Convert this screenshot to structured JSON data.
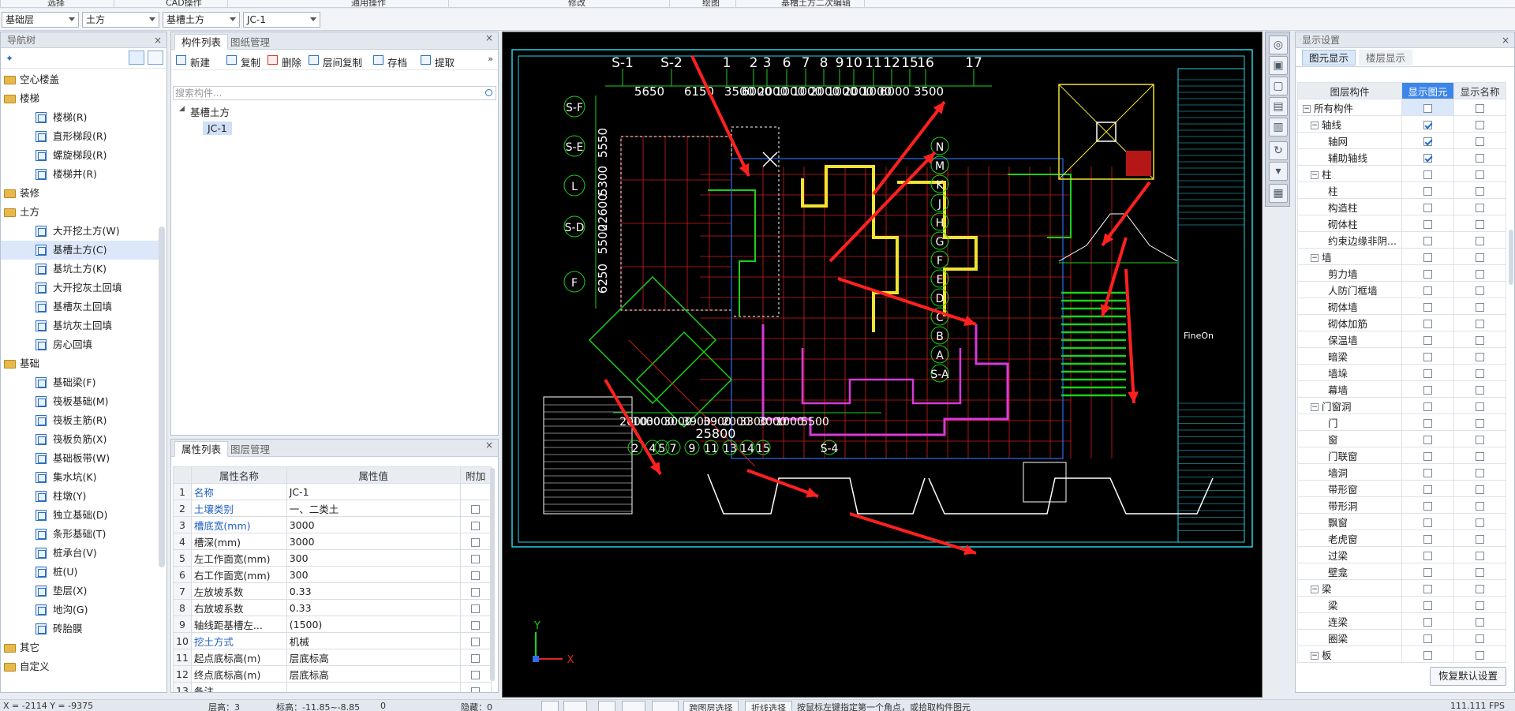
{
  "ribbon": {
    "groups": [
      "选择",
      "CAD操作",
      "通用操作",
      "修改",
      "绘图",
      "基槽土方二次编辑"
    ]
  },
  "combos": [
    "基础层",
    "土方",
    "基槽土方",
    "JC-1"
  ],
  "nav": {
    "title": "导航树",
    "tree": [
      {
        "type": "cat",
        "label": "空心楼盖"
      },
      {
        "type": "cat",
        "label": "楼梯"
      },
      {
        "type": "item",
        "label": "楼梯(R)"
      },
      {
        "type": "item",
        "label": "直形梯段(R)"
      },
      {
        "type": "item",
        "label": "螺旋梯段(R)"
      },
      {
        "type": "item",
        "label": "楼梯井(R)"
      },
      {
        "type": "cat",
        "label": "装修"
      },
      {
        "type": "cat",
        "label": "土方"
      },
      {
        "type": "item",
        "label": "大开挖土方(W)"
      },
      {
        "type": "item",
        "label": "基槽土方(C)",
        "selected": true
      },
      {
        "type": "item",
        "label": "基坑土方(K)"
      },
      {
        "type": "item",
        "label": "大开挖灰土回填"
      },
      {
        "type": "item",
        "label": "基槽灰土回填"
      },
      {
        "type": "item",
        "label": "基坑灰土回填"
      },
      {
        "type": "item",
        "label": "房心回填"
      },
      {
        "type": "cat",
        "label": "基础"
      },
      {
        "type": "item",
        "label": "基础梁(F)"
      },
      {
        "type": "item",
        "label": "筏板基础(M)"
      },
      {
        "type": "item",
        "label": "筏板主筋(R)"
      },
      {
        "type": "item",
        "label": "筏板负筋(X)"
      },
      {
        "type": "item",
        "label": "基础板带(W)"
      },
      {
        "type": "item",
        "label": "集水坑(K)"
      },
      {
        "type": "item",
        "label": "柱墩(Y)"
      },
      {
        "type": "item",
        "label": "独立基础(D)"
      },
      {
        "type": "item",
        "label": "条形基础(T)"
      },
      {
        "type": "item",
        "label": "桩承台(V)"
      },
      {
        "type": "item",
        "label": "桩(U)"
      },
      {
        "type": "item",
        "label": "垫层(X)"
      },
      {
        "type": "item",
        "label": "地沟(G)"
      },
      {
        "type": "item",
        "label": "砖胎膜"
      },
      {
        "type": "cat",
        "label": "其它"
      },
      {
        "type": "cat",
        "label": "自定义"
      }
    ]
  },
  "comp": {
    "tabs": [
      "构件列表",
      "图纸管理"
    ],
    "toolbar": [
      "新建",
      "复制",
      "删除",
      "层间复制",
      "存档",
      "提取"
    ],
    "search_placeholder": "搜索构件...",
    "tree_root": "基槽土方",
    "tree_child": "JC-1"
  },
  "props": {
    "tabs": [
      "属性列表",
      "图层管理"
    ],
    "headers": [
      "属性名称",
      "属性值",
      "附加"
    ],
    "rows": [
      {
        "idx": "1",
        "name": "名称",
        "value": "JC-1",
        "link": true,
        "check": false
      },
      {
        "idx": "2",
        "name": "土壤类别",
        "value": "一、二类土",
        "link": true,
        "check": true
      },
      {
        "idx": "3",
        "name": "槽底宽(mm)",
        "value": "3000",
        "link": true,
        "check": true
      },
      {
        "idx": "4",
        "name": "槽深(mm)",
        "value": "3000",
        "link": false,
        "check": true
      },
      {
        "idx": "5",
        "name": "左工作面宽(mm)",
        "value": "300",
        "link": false,
        "check": true
      },
      {
        "idx": "6",
        "name": "右工作面宽(mm)",
        "value": "300",
        "link": false,
        "check": true
      },
      {
        "idx": "7",
        "name": "左放坡系数",
        "value": "0.33",
        "link": false,
        "check": true
      },
      {
        "idx": "8",
        "name": "右放坡系数",
        "value": "0.33",
        "link": false,
        "check": true
      },
      {
        "idx": "9",
        "name": "轴线距基槽左...",
        "value": "(1500)",
        "link": false,
        "check": true
      },
      {
        "idx": "10",
        "name": "挖土方式",
        "value": "机械",
        "link": true,
        "check": true
      },
      {
        "idx": "11",
        "name": "起点底标高(m)",
        "value": "层底标高",
        "link": false,
        "check": true
      },
      {
        "idx": "12",
        "name": "终点底标高(m)",
        "value": "层底标高",
        "link": false,
        "check": true
      },
      {
        "idx": "13",
        "name": "备注",
        "value": "",
        "link": false,
        "check": true
      }
    ]
  },
  "drawing": {
    "top_axes": [
      "S-1",
      "S-2",
      "1",
      "2",
      "3",
      "6",
      "7",
      "8",
      "9",
      "10",
      "11",
      "12",
      "15",
      "16",
      "17"
    ],
    "top_dims": [
      "5650",
      "6150",
      "3500",
      "6000",
      "2000",
      "1000",
      "1000",
      "2000",
      "1000",
      "2000",
      "1000",
      "6000",
      "3500"
    ],
    "left_axes": [
      "S-F",
      "S-E",
      "L",
      "S-D",
      "F"
    ],
    "left_dims": [
      "5550",
      "5300",
      "22600",
      "5500",
      "6250"
    ],
    "right_axes": [
      "N",
      "M",
      "K",
      "J",
      "H",
      "G",
      "F",
      "E",
      "D",
      "C",
      "B",
      "A",
      "S-A"
    ],
    "bottom_axes": [
      "2",
      "4",
      "5",
      "7",
      "9",
      "11",
      "13",
      "14",
      "15",
      "S-4"
    ],
    "bottom_dim": "25800",
    "bottom_dims": [
      "2000",
      "1000",
      "3000",
      "3000",
      "3900",
      "3900",
      "2000",
      "3300",
      "3000",
      "1000",
      "5500"
    ],
    "axis_x": "X",
    "axis_y": "Y",
    "company": "FineOn"
  },
  "disp": {
    "title": "显示设置",
    "tabs": [
      "图元显示",
      "楼层显示"
    ],
    "headers": [
      "图层构件",
      "显示图元",
      "显示名称"
    ],
    "rows": [
      {
        "label": "所有构件",
        "level": 0,
        "exp": "-",
        "show": false,
        "name": false
      },
      {
        "label": "轴线",
        "level": 1,
        "exp": "-",
        "show": true,
        "name": false
      },
      {
        "label": "轴网",
        "level": 2,
        "show": true,
        "name": false
      },
      {
        "label": "辅助轴线",
        "level": 2,
        "show": true,
        "name": false
      },
      {
        "label": "柱",
        "level": 1,
        "exp": "-",
        "show": false,
        "name": false
      },
      {
        "label": "柱",
        "level": 2,
        "show": false,
        "name": false
      },
      {
        "label": "构造柱",
        "level": 2,
        "show": false,
        "name": false
      },
      {
        "label": "砌体柱",
        "level": 2,
        "show": false,
        "name": false
      },
      {
        "label": "约束边缘非阴...",
        "level": 2,
        "show": false,
        "name": false
      },
      {
        "label": "墙",
        "level": 1,
        "exp": "-",
        "show": false,
        "name": false
      },
      {
        "label": "剪力墙",
        "level": 2,
        "show": false,
        "name": false
      },
      {
        "label": "人防门框墙",
        "level": 2,
        "show": false,
        "name": false
      },
      {
        "label": "砌体墙",
        "level": 2,
        "show": false,
        "name": false
      },
      {
        "label": "砌体加筋",
        "level": 2,
        "show": false,
        "name": false
      },
      {
        "label": "保温墙",
        "level": 2,
        "show": false,
        "name": false
      },
      {
        "label": "暗梁",
        "level": 2,
        "show": false,
        "name": false
      },
      {
        "label": "墙垛",
        "level": 2,
        "show": false,
        "name": false
      },
      {
        "label": "幕墙",
        "level": 2,
        "show": false,
        "name": false
      },
      {
        "label": "门窗洞",
        "level": 1,
        "exp": "-",
        "show": false,
        "name": false
      },
      {
        "label": "门",
        "level": 2,
        "show": false,
        "name": false
      },
      {
        "label": "窗",
        "level": 2,
        "show": false,
        "name": false
      },
      {
        "label": "门联窗",
        "level": 2,
        "show": false,
        "name": false
      },
      {
        "label": "墙洞",
        "level": 2,
        "show": false,
        "name": false
      },
      {
        "label": "带形窗",
        "level": 2,
        "show": false,
        "name": false
      },
      {
        "label": "带形洞",
        "level": 2,
        "show": false,
        "name": false
      },
      {
        "label": "飘窗",
        "level": 2,
        "show": false,
        "name": false
      },
      {
        "label": "老虎窗",
        "level": 2,
        "show": false,
        "name": false
      },
      {
        "label": "过梁",
        "level": 2,
        "show": false,
        "name": false
      },
      {
        "label": "壁龛",
        "level": 2,
        "show": false,
        "name": false
      },
      {
        "label": "梁",
        "level": 1,
        "exp": "-",
        "show": false,
        "name": false
      },
      {
        "label": "梁",
        "level": 2,
        "show": false,
        "name": false
      },
      {
        "label": "连梁",
        "level": 2,
        "show": false,
        "name": false
      },
      {
        "label": "圈梁",
        "level": 2,
        "show": false,
        "name": false
      },
      {
        "label": "板",
        "level": 1,
        "exp": "-",
        "show": false,
        "name": false
      }
    ],
    "restore": "恢复默认设置"
  },
  "status": {
    "coords": "X = -2114 Y = -9375",
    "floor": "层高：3",
    "elev": "标高：-11.85~-8.85",
    "zero": "0",
    "hidden": "隐藏：0",
    "btn1": "跨图层选择",
    "btn2": "折线选择",
    "hint": "按鼠标左键指定第一个角点，或拾取构件图元",
    "fps": "111.111 FPS"
  }
}
